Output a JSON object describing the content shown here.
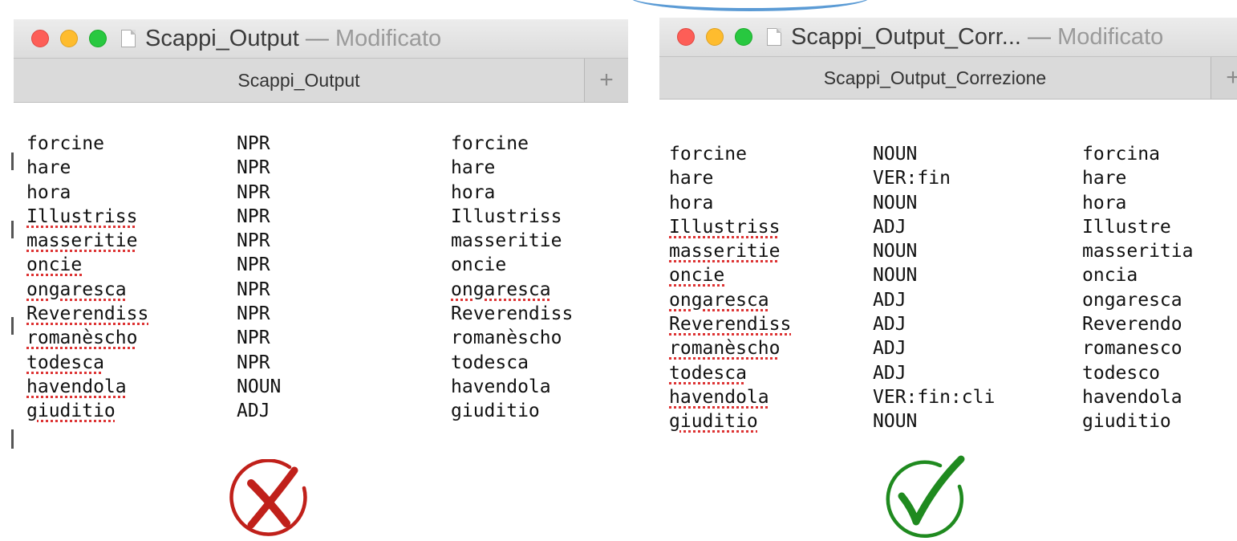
{
  "left_window": {
    "title": "Scappi_Output",
    "separator": "—",
    "status": "Modificato",
    "tab_label": "Scappi_Output",
    "new_tab_symbol": "+",
    "rows": [
      {
        "token": "forcine",
        "pos": "NPR",
        "lemma": "forcine"
      },
      {
        "token": "hare",
        "pos": "NPR",
        "lemma": "hare"
      },
      {
        "token": "hora",
        "pos": "NPR",
        "lemma": "hora"
      },
      {
        "token": "Illustriss",
        "pos": "NPR",
        "lemma": "Illustriss"
      },
      {
        "token": "masseritie",
        "pos": "NPR",
        "lemma": "masseritie"
      },
      {
        "token": "oncie",
        "pos": "NPR",
        "lemma": "oncie"
      },
      {
        "token": "ongaresca",
        "pos": "NPR",
        "lemma": "ongaresca"
      },
      {
        "token": "Reverendiss",
        "pos": "NPR",
        "lemma": "Reverendiss"
      },
      {
        "token": "romanèscho",
        "pos": "NPR",
        "lemma": "romanèscho"
      },
      {
        "token": "todesca",
        "pos": "NPR",
        "lemma": "todesca"
      },
      {
        "token": "havendola",
        "pos": "NOUN",
        "lemma": "havendola"
      },
      {
        "token": "giuditio",
        "pos": "ADJ",
        "lemma": "giuditio"
      }
    ],
    "verdict_icon": "red-cross-circle-icon",
    "verdict_color": "#c0201a"
  },
  "right_window": {
    "title": "Scappi_Output_Corr...",
    "separator": "—",
    "status": "Modificato",
    "tab_label": "Scappi_Output_Correzione",
    "new_tab_symbol": "+",
    "rows": [
      {
        "token": "forcine",
        "pos": "NOUN",
        "lemma": "forcina"
      },
      {
        "token": "hare",
        "pos": "VER:fin",
        "lemma": "hare"
      },
      {
        "token": "hora",
        "pos": "NOUN",
        "lemma": "hora"
      },
      {
        "token": "Illustriss",
        "pos": "ADJ",
        "lemma": "Illustre"
      },
      {
        "token": "masseritie",
        "pos": "NOUN",
        "lemma": "masseritia"
      },
      {
        "token": "oncie",
        "pos": "NOUN",
        "lemma": "oncia"
      },
      {
        "token": "ongaresca",
        "pos": "ADJ",
        "lemma": "ongaresca"
      },
      {
        "token": "Reverendiss",
        "pos": "ADJ",
        "lemma": "Reverendo"
      },
      {
        "token": "romanèscho",
        "pos": "ADJ",
        "lemma": "romanesco"
      },
      {
        "token": "todesca",
        "pos": "ADJ",
        "lemma": "todesco"
      },
      {
        "token": "havendola",
        "pos": "VER:fin:cli",
        "lemma": "havendola"
      },
      {
        "token": "giuditio",
        "pos": "NOUN",
        "lemma": "giuditio"
      }
    ],
    "verdict_icon": "green-check-circle-icon",
    "verdict_color": "#1f8a1f"
  },
  "colors": {
    "close": "#fd5e57",
    "minimize": "#febc2e",
    "zoom": "#28c840",
    "spellcheck_underline": "#d33333",
    "accent_arc": "#5b9bd5"
  }
}
